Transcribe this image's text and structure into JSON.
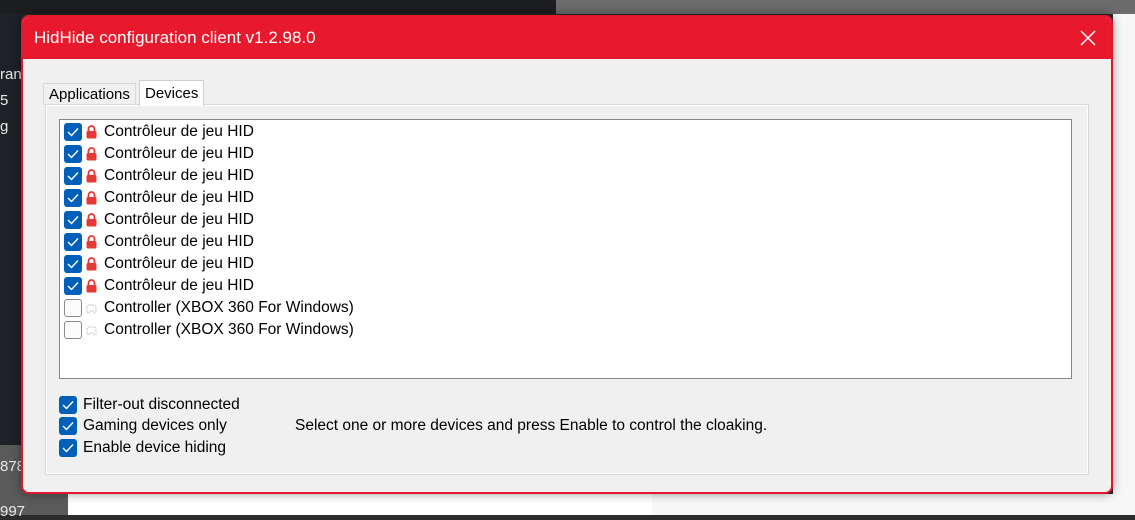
{
  "window": {
    "title": "HidHide configuration client v1.2.98.0"
  },
  "tabs": [
    {
      "label": "Applications",
      "selected": false
    },
    {
      "label": "Devices",
      "selected": true
    }
  ],
  "devices": [
    {
      "label": "Contrôleur de jeu HID",
      "checked": true,
      "icon": "lock-icon"
    },
    {
      "label": "Contrôleur de jeu HID",
      "checked": true,
      "icon": "lock-icon"
    },
    {
      "label": "Contrôleur de jeu HID",
      "checked": true,
      "icon": "lock-icon"
    },
    {
      "label": "Contrôleur de jeu HID",
      "checked": true,
      "icon": "lock-icon"
    },
    {
      "label": "Contrôleur de jeu HID",
      "checked": true,
      "icon": "lock-icon"
    },
    {
      "label": "Contrôleur de jeu HID",
      "checked": true,
      "icon": "lock-icon"
    },
    {
      "label": "Contrôleur de jeu HID",
      "checked": true,
      "icon": "lock-icon"
    },
    {
      "label": "Contrôleur de jeu HID",
      "checked": true,
      "icon": "lock-icon"
    },
    {
      "label": "Controller (XBOX 360 For Windows)",
      "checked": false,
      "icon": "gamepad-icon"
    },
    {
      "label": "Controller (XBOX 360 For Windows)",
      "checked": false,
      "icon": "gamepad-icon"
    }
  ],
  "options": [
    {
      "label": "Filter-out disconnected",
      "checked": true
    },
    {
      "label": "Gaming devices only",
      "checked": true
    },
    {
      "label": "Enable device hiding",
      "checked": true
    }
  ],
  "hint": "Select one or more devices and press Enable to control the cloaking.",
  "background": {
    "left_fragments": [
      "ran",
      "5",
      "g",
      "878",
      "997"
    ]
  },
  "colors": {
    "accent": "#e8192d",
    "checkbox": "#005fb8",
    "lock": "#e53935"
  }
}
